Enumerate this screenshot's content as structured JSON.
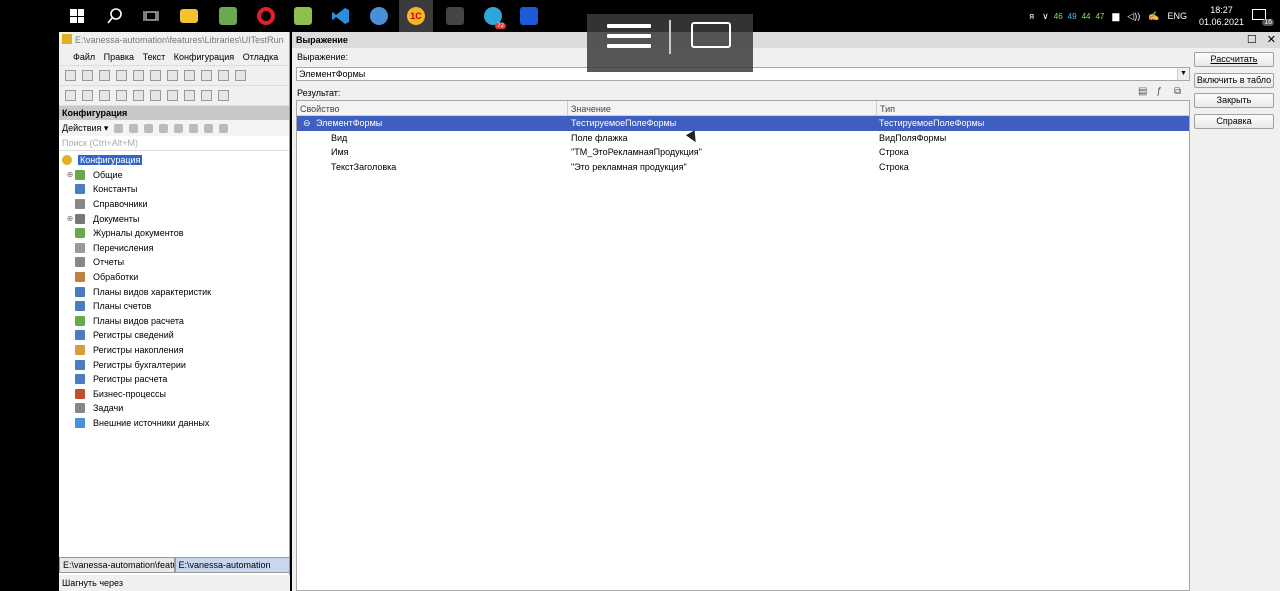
{
  "taskbar": {
    "tray": {
      "lang_icon": "ᴙ",
      "nums": [
        "46",
        "49",
        "44",
        "47"
      ],
      "language": "ENG",
      "time": "18:27",
      "date": "01.06.2021",
      "notif_count": "16"
    },
    "telegram_badge": "72"
  },
  "configurator": {
    "title": "E:\\vanessa-automation\\features\\Libraries\\UITestRun",
    "menu": [
      "Файл",
      "Правка",
      "Текст",
      "Конфигурация",
      "Отладка"
    ],
    "panel_title": "Конфигурация",
    "actions_label": "Действия ▾",
    "search_placeholder": "Поиск (Ctrl+Alt+M)",
    "tree": [
      {
        "label": "Конфигурация",
        "icon": "config-icon",
        "exp": "",
        "selected": true,
        "indent": 0
      },
      {
        "label": "Общие",
        "icon": "common-icon",
        "exp": "⊕",
        "indent": 1
      },
      {
        "label": "Константы",
        "icon": "constants-icon",
        "exp": "",
        "indent": 1
      },
      {
        "label": "Справочники",
        "icon": "catalogs-icon",
        "exp": "",
        "indent": 1
      },
      {
        "label": "Документы",
        "icon": "documents-icon",
        "exp": "⊕",
        "indent": 1
      },
      {
        "label": "Журналы документов",
        "icon": "journals-icon",
        "exp": "",
        "indent": 1
      },
      {
        "label": "Перечисления",
        "icon": "enums-icon",
        "exp": "",
        "indent": 1
      },
      {
        "label": "Отчеты",
        "icon": "reports-icon",
        "exp": "",
        "indent": 1
      },
      {
        "label": "Обработки",
        "icon": "dataprocessors-icon",
        "exp": "",
        "indent": 1
      },
      {
        "label": "Планы видов характеристик",
        "icon": "chart-char-icon",
        "exp": "",
        "indent": 1
      },
      {
        "label": "Планы счетов",
        "icon": "chart-accounts-icon",
        "exp": "",
        "indent": 1
      },
      {
        "label": "Планы видов расчета",
        "icon": "chart-calc-icon",
        "exp": "",
        "indent": 1
      },
      {
        "label": "Регистры сведений",
        "icon": "info-registers-icon",
        "exp": "",
        "indent": 1
      },
      {
        "label": "Регистры накопления",
        "icon": "accum-registers-icon",
        "exp": "",
        "indent": 1
      },
      {
        "label": "Регистры бухгалтерии",
        "icon": "acc-registers-icon",
        "exp": "",
        "indent": 1
      },
      {
        "label": "Регистры расчета",
        "icon": "calc-registers-icon",
        "exp": "",
        "indent": 1
      },
      {
        "label": "Бизнес-процессы",
        "icon": "bp-icon",
        "exp": "",
        "indent": 1
      },
      {
        "label": "Задачи",
        "icon": "tasks-icon",
        "exp": "",
        "indent": 1
      },
      {
        "label": "Внешние источники данных",
        "icon": "ext-sources-icon",
        "exp": "",
        "indent": 1
      }
    ],
    "window_tabs": [
      "E:\\vanessa-automation\\featur...",
      "E:\\vanessa-automation"
    ],
    "status": "Шагнуть через"
  },
  "dialog": {
    "title": "Выражение",
    "expr_label": "Выражение:",
    "expr_value": "ЭлементФормы",
    "result_label": "Результат:",
    "columns": [
      "Свойство",
      "Значение",
      "Тип"
    ],
    "rows": [
      {
        "prop": "ЭлементФормы",
        "value": "ТестируемоеПолеФормы",
        "type": "ТестируемоеПолеФормы",
        "selected": true,
        "toggle": "⊖"
      },
      {
        "prop": "Вид",
        "value": "Поле флажка",
        "type": "ВидПоляФормы",
        "selected": false,
        "toggle": ""
      },
      {
        "prop": "Имя",
        "value": "\"ТМ_ЭтоРекламнаяПродукция\"",
        "type": "Строка",
        "selected": false,
        "toggle": ""
      },
      {
        "prop": "ТекстЗаголовка",
        "value": "\"Это рекламная продукция\"",
        "type": "Строка",
        "selected": false,
        "toggle": ""
      }
    ],
    "buttons": {
      "calculate": "Рассчитать",
      "add_to_table": "Включить в табло",
      "close": "Закрыть",
      "help": "Справка"
    }
  },
  "colors": {
    "selection": "#3e5fbf",
    "tree_selection": "#3366cc",
    "panel_head": "#c8c8c8"
  }
}
